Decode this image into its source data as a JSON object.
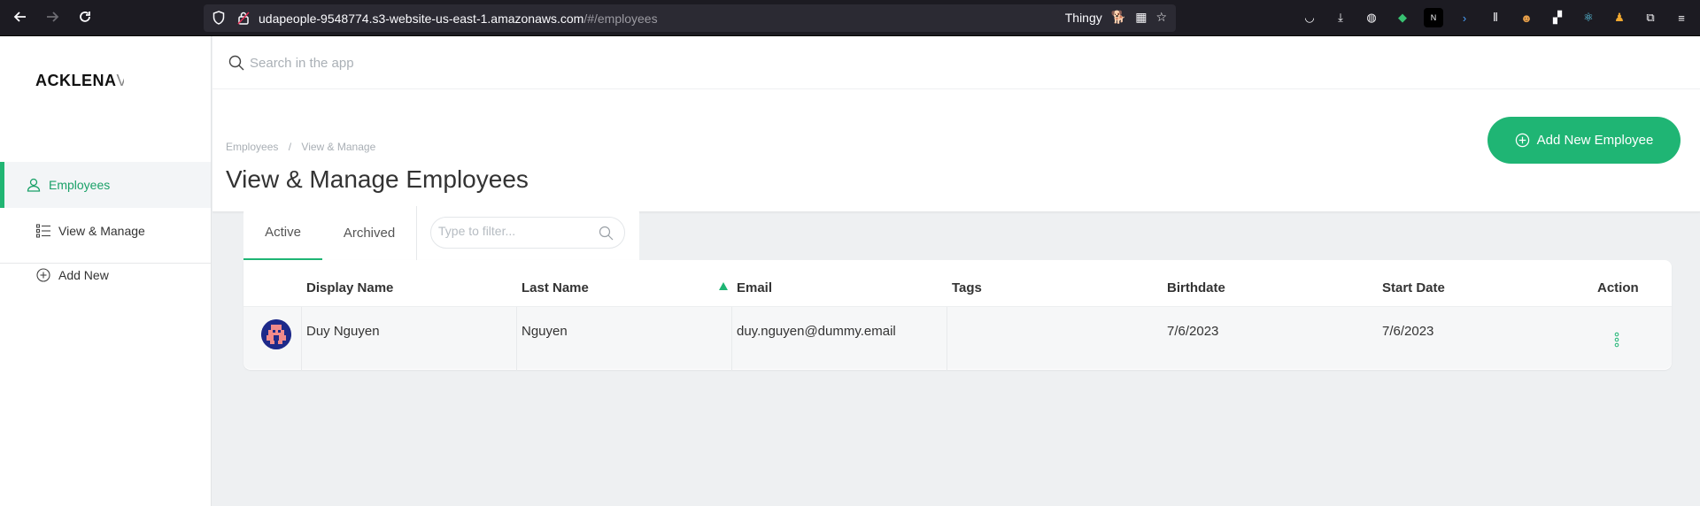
{
  "browser": {
    "url_main": "udapeople-9548774.s3-website-us-east-1.amazonaws.com",
    "url_dim": "/#/employees",
    "extension_label": "Thingy"
  },
  "sidebar": {
    "logo_bold": "ACKLENA",
    "logo_faded": "V",
    "items": [
      {
        "label": "Employees"
      },
      {
        "label": "View & Manage"
      },
      {
        "label": "Add New"
      }
    ]
  },
  "search": {
    "placeholder": "Search in the app"
  },
  "header": {
    "breadcrumb": [
      "Employees",
      "View & Manage"
    ],
    "breadcrumb_sep": "/",
    "title": "View & Manage Employees",
    "add_button": "Add New Employee"
  },
  "tabs": [
    {
      "label": "Active"
    },
    {
      "label": "Archived"
    }
  ],
  "filter": {
    "placeholder": "Type to filter..."
  },
  "table": {
    "headers": [
      "Display Name",
      "Last Name",
      "Email",
      "Tags",
      "Birthdate",
      "Start Date",
      "Action"
    ],
    "rows": [
      {
        "display_name": "Duy Nguyen",
        "last_name": "Nguyen",
        "email": "duy.nguyen@dummy.email",
        "tags": "",
        "birthdate": "7/6/2023",
        "start_date": "7/6/2023"
      }
    ]
  },
  "colors": {
    "accent": "#1fb574",
    "browser_bg": "#1c1b22"
  }
}
